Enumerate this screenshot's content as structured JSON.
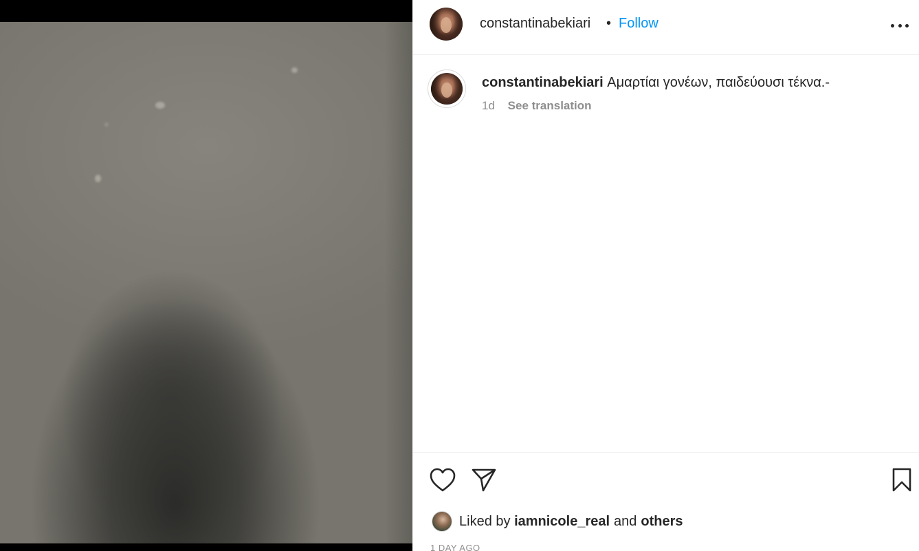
{
  "post": {
    "author": "constantinabekiari",
    "separator": "•",
    "follow_label": "Follow",
    "more_icon": "more-horizontal-icon"
  },
  "caption": {
    "username": "constantinabekiari",
    "text": "Αμαρτίαι γονέων, παιδεύουσι τέκνα.-",
    "ago": "1d",
    "translate_label": "See translation"
  },
  "actions": {
    "like_icon": "heart-icon",
    "share_icon": "paper-plane-icon",
    "save_icon": "bookmark-icon"
  },
  "likes": {
    "prefix": "Liked by",
    "user": "iamnicole_real",
    "conjunction": "and",
    "others": "others"
  },
  "timestamp": "1 DAY AGO",
  "colors": {
    "link_blue": "#0095f6",
    "text": "#262626",
    "muted": "#8e8e8e",
    "divider": "#efefef"
  }
}
